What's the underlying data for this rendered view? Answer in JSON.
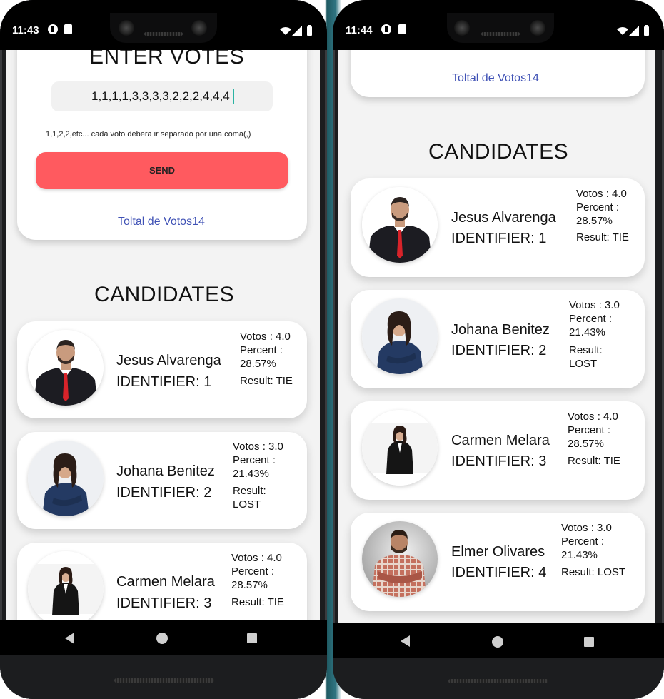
{
  "left_phone": {
    "status_time": "11:43",
    "votes_card": {
      "title": "ENTER VOTES",
      "input_value": "1,1,1,1,3,3,3,3,2,2,2,4,4,4",
      "hint": "1,1,2,2,etc... cada voto debera ir separado por una coma(,)",
      "send_label": "SEND",
      "total_label": "Toltal de Votos14"
    },
    "candidates_title": "CANDIDATES",
    "candidates": [
      {
        "name": "Jesus Alvarenga",
        "identifier": "IDENTIFIER: 1",
        "votes": "Votos : 4.0",
        "percent_label": "Percent :",
        "percent": "28.57%",
        "result": "Result: TIE",
        "avatar": "man-suit-red-tie-avatar"
      },
      {
        "name": "Johana Benitez",
        "identifier": "IDENTIFIER: 2",
        "votes": "Votos : 3.0",
        "percent_label": "Percent :",
        "percent": "21.43%",
        "result": "Result:",
        "result2": "LOST",
        "avatar": "woman-navy-suit-avatar"
      },
      {
        "name": "Carmen Melara",
        "identifier": "IDENTIFIER: 3",
        "votes": "Votos : 4.0",
        "percent_label": "Percent :",
        "percent": "28.57%",
        "result": "Result: TIE",
        "avatar": "woman-black-suit-avatar"
      }
    ]
  },
  "right_phone": {
    "status_time": "11:44",
    "total_label": "Toltal de Votos14",
    "candidates_title": "CANDIDATES",
    "candidates": [
      {
        "name": "Jesus Alvarenga",
        "identifier": "IDENTIFIER: 1",
        "votes": "Votos : 4.0",
        "percent_label": "Percent :",
        "percent": "28.57%",
        "result": "Result: TIE",
        "avatar": "man-suit-red-tie-avatar"
      },
      {
        "name": "Johana Benitez",
        "identifier": "IDENTIFIER: 2",
        "votes": "Votos : 3.0",
        "percent_label": "Percent :",
        "percent": "21.43%",
        "result": "Result:",
        "result2": "LOST",
        "avatar": "woman-navy-suit-avatar"
      },
      {
        "name": "Carmen Melara",
        "identifier": "IDENTIFIER: 3",
        "votes": "Votos : 4.0",
        "percent_label": "Percent :",
        "percent": "28.57%",
        "result": "Result: TIE",
        "avatar": "woman-black-suit-avatar"
      },
      {
        "name": "Elmer Olivares",
        "identifier": "IDENTIFIER: 4",
        "votes": "Votos : 3.0",
        "percent_label": "Percent :",
        "percent": "21.43%",
        "result": "Result: LOST",
        "avatar": "man-plaid-shirt-avatar"
      }
    ]
  },
  "colors": {
    "send_button": "#ff5a5f",
    "link": "#3f51b5",
    "phone_frame": "#1c1d1f",
    "screen_bg": "#f3f3f3"
  }
}
